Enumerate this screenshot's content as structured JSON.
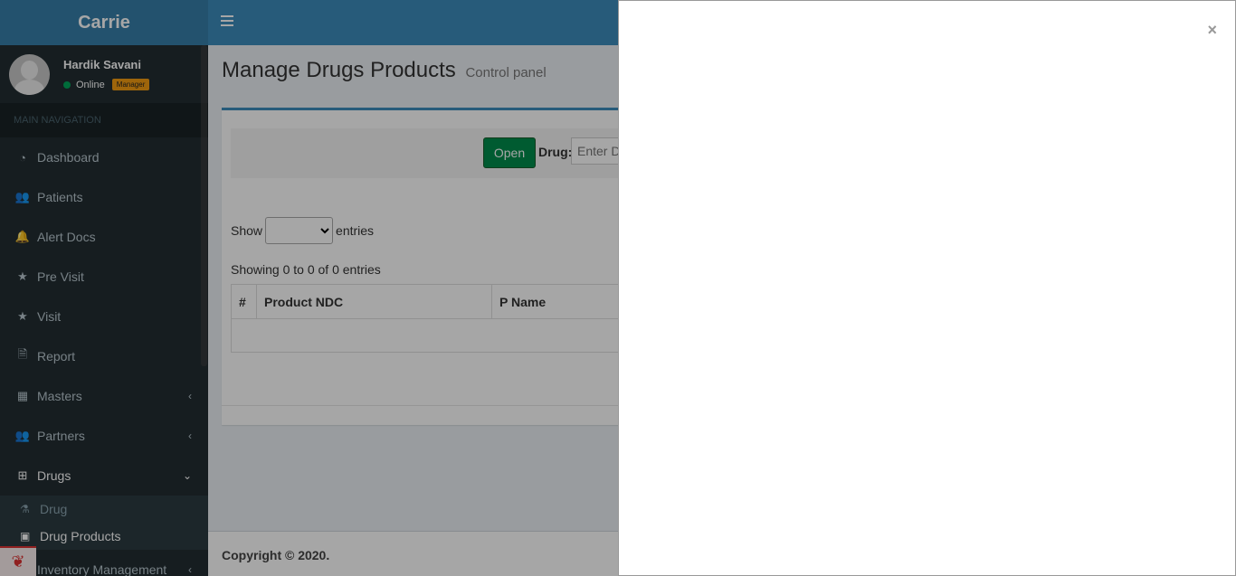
{
  "brand": "Carrie",
  "user": {
    "name": "Hardik Savani",
    "status": "Online",
    "role": "Manager"
  },
  "sidebar": {
    "header": "MAIN NAVIGATION",
    "items": [
      {
        "label": "Dashboard",
        "icon": "dashboard-icon"
      },
      {
        "label": "Patients",
        "icon": "users-icon"
      },
      {
        "label": "Alert Docs",
        "icon": "bell-icon"
      },
      {
        "label": "Pre Visit",
        "icon": "star-icon"
      },
      {
        "label": "Visit",
        "icon": "star-icon"
      },
      {
        "label": "Report",
        "icon": "file-pdf-icon"
      },
      {
        "label": "Masters",
        "icon": "grid-icon"
      },
      {
        "label": "Partners",
        "icon": "users-icon"
      },
      {
        "label": "Drugs",
        "icon": "medkit-icon"
      }
    ],
    "drugs_sub": [
      {
        "label": "Drug",
        "icon": "flask-icon"
      },
      {
        "label": "Drug Products",
        "icon": "briefcase-icon"
      }
    ],
    "inventory": "Inventory Management"
  },
  "page": {
    "title": "Manage Drugs Products",
    "subtitle": "Control panel"
  },
  "filter": {
    "open_label": "Open",
    "drug_label": "Drug:",
    "drug_placeholder": "Enter Drug"
  },
  "table": {
    "show_label": "Show",
    "entries_label": "entries",
    "info": "Showing 0 to 0 of 0 entries",
    "columns": [
      "#",
      "Product NDC",
      "P Name"
    ]
  },
  "footer": {
    "copyright": "Copyright © 2020."
  },
  "modal": {
    "close": "×"
  }
}
